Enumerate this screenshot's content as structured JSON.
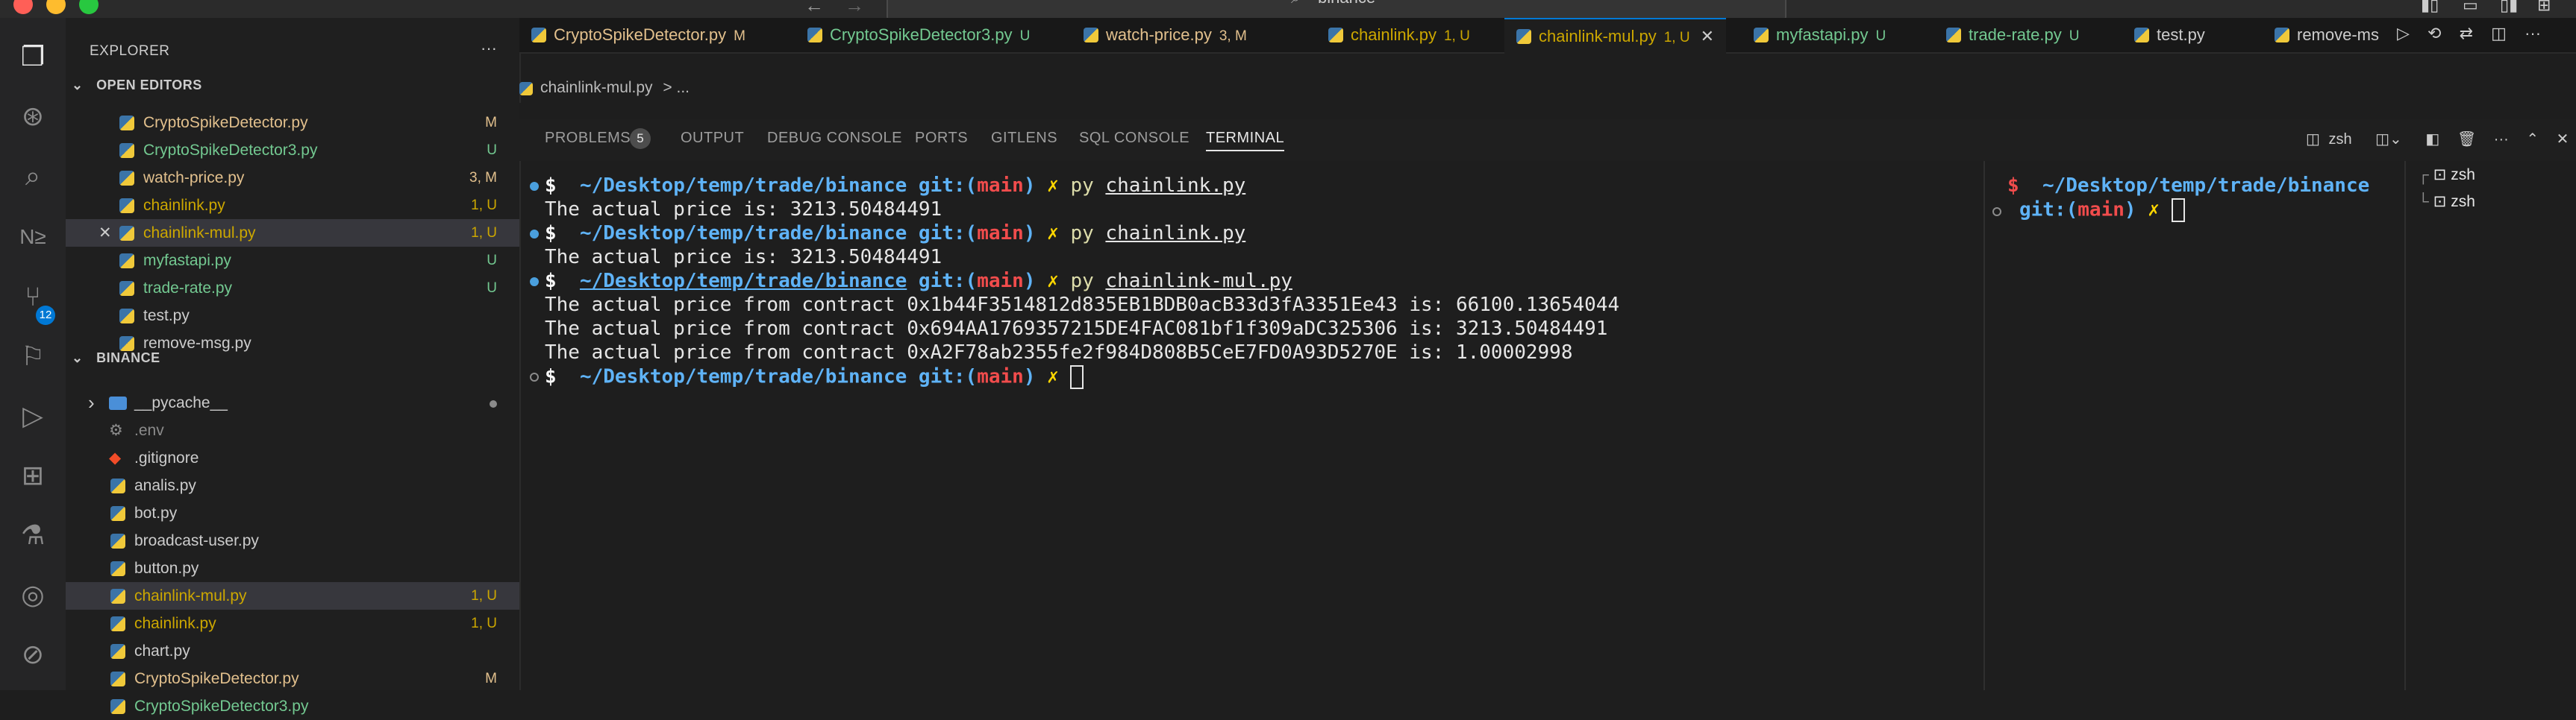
{
  "search": {
    "text": "binance"
  },
  "sidebar": {
    "title": "EXPLORER",
    "open_editors_label": "OPEN EDITORS",
    "open_editors": [
      {
        "name": "CryptoSpikeDetector.py",
        "badge": "M",
        "color": "#e2c08d"
      },
      {
        "name": "CryptoSpikeDetector3.py",
        "badge": "U",
        "color": "#73c991"
      },
      {
        "name": "watch-price.py",
        "badge": "3, M",
        "color": "#e2c08d"
      },
      {
        "name": "chainlink.py",
        "badge": "1, U",
        "color": "#cca700"
      },
      {
        "name": "chainlink-mul.py",
        "badge": "1, U",
        "color": "#cca700"
      },
      {
        "name": "myfastapi.py",
        "badge": "U",
        "color": "#73c991"
      },
      {
        "name": "trade-rate.py",
        "badge": "U",
        "color": "#73c991"
      },
      {
        "name": "test.py",
        "badge": "",
        "color": "#cccccc"
      },
      {
        "name": "remove-msg.py",
        "badge": "",
        "color": "#cccccc"
      }
    ],
    "folder_label": "BINANCE",
    "files": [
      {
        "name": "__pycache__",
        "badge": "",
        "color": "#cccccc"
      },
      {
        "name": ".env",
        "badge": "",
        "color": "#8b8b8b"
      },
      {
        "name": ".gitignore",
        "badge": "",
        "color": "#cccccc"
      },
      {
        "name": "analis.py",
        "badge": "",
        "color": "#cccccc"
      },
      {
        "name": "bot.py",
        "badge": "",
        "color": "#cccccc"
      },
      {
        "name": "broadcast-user.py",
        "badge": "",
        "color": "#cccccc"
      },
      {
        "name": "button.py",
        "badge": "",
        "color": "#cccccc"
      },
      {
        "name": "chainlink-mul.py",
        "badge": "1, U",
        "color": "#cca700"
      },
      {
        "name": "chainlink.py",
        "badge": "1, U",
        "color": "#cca700"
      },
      {
        "name": "chart.py",
        "badge": "",
        "color": "#cccccc"
      },
      {
        "name": "CryptoSpikeDetector.py",
        "badge": "M",
        "color": "#e2c08d"
      },
      {
        "name": "CryptoSpikeDetector3.py",
        "badge": "",
        "color": "#73c991"
      }
    ]
  },
  "tabs": [
    {
      "label": "CryptoSpikeDetector.py",
      "badge": "M",
      "color": "#e2c08d"
    },
    {
      "label": "CryptoSpikeDetector3.py",
      "badge": "U",
      "color": "#73c991"
    },
    {
      "label": "watch-price.py",
      "badge": "3, M",
      "color": "#e2c08d"
    },
    {
      "label": "chainlink.py",
      "badge": "1, U",
      "color": "#cca700"
    },
    {
      "label": "chainlink-mul.py",
      "badge": "1, U",
      "color": "#cca700"
    },
    {
      "label": "myfastapi.py",
      "badge": "U",
      "color": "#73c991"
    },
    {
      "label": "trade-rate.py",
      "badge": "U",
      "color": "#73c991"
    },
    {
      "label": "test.py",
      "badge": "",
      "color": "#cccccc"
    },
    {
      "label": "remove-ms",
      "badge": "",
      "color": "#cccccc"
    }
  ],
  "breadcrumb": {
    "file": "chainlink-mul.py",
    "rest": "> ..."
  },
  "panel": {
    "tabs": [
      "PROBLEMS",
      "OUTPUT",
      "DEBUG CONSOLE",
      "PORTS",
      "GITLENS",
      "SQL CONSOLE",
      "TERMINAL"
    ],
    "problems_count": "5",
    "shell_label": "zsh"
  },
  "terminal": {
    "prompt_sym": "$",
    "path": "~/Desktop/temp/trade/binance",
    "git": "git:(",
    "branch": "main",
    "git_close": ")",
    "x": "✗",
    "py": "py",
    "cmd1": "chainlink.py",
    "out1": "The actual price is: 3213.50484491",
    "cmd2": "chainlink.py",
    "out2": "The actual price is: 3213.50484491",
    "cmd3": "chainlink-mul.py",
    "out3a": "The actual price from contract 0x1b44F3514812d835EB1BDB0acB33d3fA3351Ee43 is: 66100.13654044",
    "out3b": "The actual price from contract 0x694AA1769357215DE4FAC081bf1f309aDC325306 is: 3213.50484491",
    "out3c": "The actual price from contract 0xA2F78ab2355fe2f984D808B5CeE7FD0A93D5270E is: 1.00002998"
  },
  "terminal_list": [
    "zsh",
    "zsh"
  ],
  "activity_badge": "12"
}
